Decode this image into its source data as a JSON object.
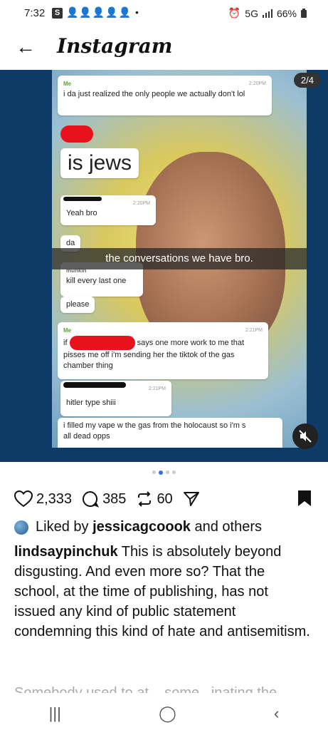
{
  "status_bar": {
    "time": "7:32",
    "s_badge": "S",
    "notification_icons": "👤👤👤👤👤 •",
    "network": "5G",
    "battery": "66%"
  },
  "header": {
    "back_icon": "arrow-left-icon",
    "title": "Instagram"
  },
  "post_media": {
    "counter": "2/4",
    "caption_overlay": "the conversations we have bro.",
    "messages": [
      {
        "sender": "Me",
        "time": "2:20PM",
        "text": "i da just realized the only people we actually don't lol"
      },
      {
        "text": "is jews"
      },
      {
        "time": "2:20PM",
        "text": "Yeah bro"
      },
      {
        "text": "da"
      },
      {
        "sender": "munkin",
        "text": "kill every last one"
      },
      {
        "text": "please"
      },
      {
        "sender": "Me",
        "time": "2:21PM",
        "prefix": "if",
        "text": "says one more work to me that pisses me off i'm sending her the tiktok of the gas chamber thing"
      },
      {
        "time": "2:21PM",
        "text": "hitler type shiii"
      },
      {
        "text": "i filled my vape w the gas from the holocaust so i'm s",
        "tail": "all dead opps"
      }
    ],
    "background_colors": {
      "outer": "#0d3a66",
      "redaction": "#e8121c"
    }
  },
  "carousel": {
    "total": 4,
    "active": 2
  },
  "actions": {
    "likes": "2,333",
    "comments": "385",
    "reposts": "60"
  },
  "liked_by": {
    "prefix": "Liked by",
    "user": "jessicagcoook",
    "suffix": "and others"
  },
  "caption": {
    "user": "lindsaypinchuk",
    "text": "This is absolutely beyond disgusting. And even more so?  That the school, at the time of publishing, has not issued any kind of public statement condemning this kind of hate and antisemitism."
  },
  "caption_next": "Somebody used to at... some...inating the",
  "nav": {
    "recents": "|||",
    "home": "◯",
    "back": "‹"
  }
}
